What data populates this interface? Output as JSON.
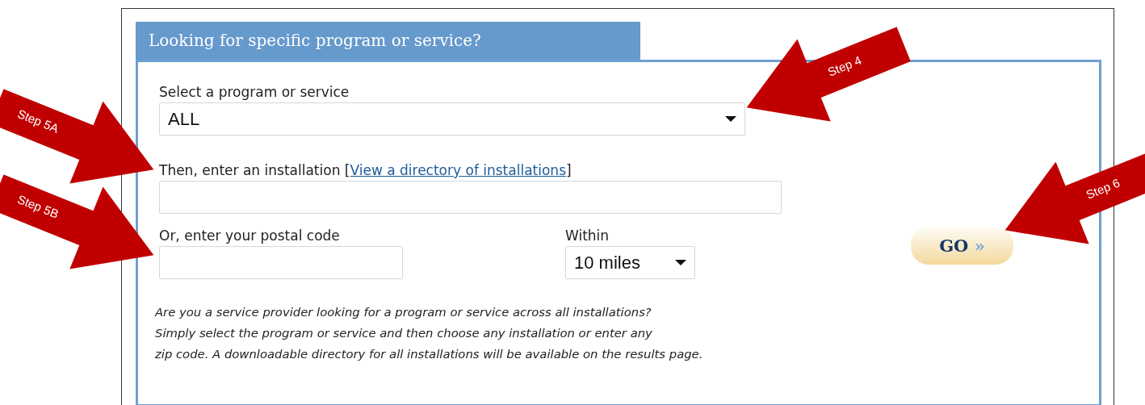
{
  "panel": {
    "tab_title": "Looking for specific program or service?"
  },
  "program_field": {
    "label": "Select a program or service",
    "value": "ALL"
  },
  "installation_field": {
    "label_before": "Then, enter an installation [",
    "link": "View a directory of installations",
    "label_after": "]"
  },
  "postal_field": {
    "label": "Or, enter your postal code"
  },
  "distance_field": {
    "label": "Within",
    "value": "10 miles"
  },
  "go_button": {
    "label": "GO",
    "icon_text": "»"
  },
  "note_lines": [
    "Are you a service provider looking for a program or service across all installations?",
    "Simply select the program or service and then choose any installation or enter any",
    "zip code. A downloadable directory for all installations will be available on the results page."
  ],
  "callouts": [
    {
      "text": "Step 4",
      "kind": "leftward"
    },
    {
      "text": "Step 5A",
      "kind": "rightward"
    },
    {
      "text": "Step 5B",
      "kind": "rightward"
    },
    {
      "text": "Step 6",
      "kind": "leftward"
    }
  ]
}
